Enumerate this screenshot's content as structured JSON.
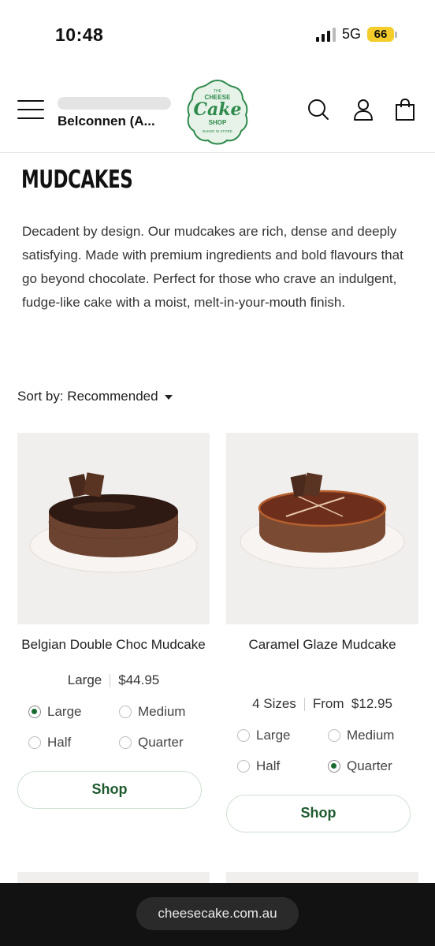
{
  "status_bar": {
    "time": "10:48",
    "network": "5G",
    "battery": "66"
  },
  "header": {
    "store_name": "Belconnen (A...",
    "logo": {
      "top_text": "THE",
      "text_1": "CHEESE",
      "text_2": "Cake",
      "text_3": "SHOP",
      "bottom_text": "BAKED IN STORE",
      "color": "#2f8a4b"
    },
    "icons": [
      "menu-icon",
      "search-icon",
      "account-icon",
      "cart-icon"
    ]
  },
  "page": {
    "title": "MUDCAKES",
    "description": "Decadent by design. Our mudcakes are rich, dense and deeply satisfying. Made with premium ingredients and bold flavours that go beyond chocolate. Perfect for those who crave an indulgent, fudge-like cake with a moist, melt-in-your-mouth finish.",
    "sort_label": "Sort by: Recommended"
  },
  "products": [
    {
      "name": "Belgian Double Choc Mudcake",
      "meta_left": "Large",
      "meta_right": "$44.95",
      "options": [
        "Large",
        "Medium",
        "Half",
        "Quarter"
      ],
      "selected": "Large",
      "button": "Shop"
    },
    {
      "name": "Caramel Glaze Mudcake",
      "meta_left": "4 Sizes",
      "meta_right": "From  $12.95",
      "options": [
        "Large",
        "Medium",
        "Half",
        "Quarter"
      ],
      "selected": "Quarter",
      "button": "Shop"
    }
  ],
  "browser": {
    "url": "cheesecake.com.au"
  },
  "colors": {
    "accent_green": "#1a6b2f",
    "button_text": "#1e5a2e",
    "battery": "#f4cd2a"
  }
}
